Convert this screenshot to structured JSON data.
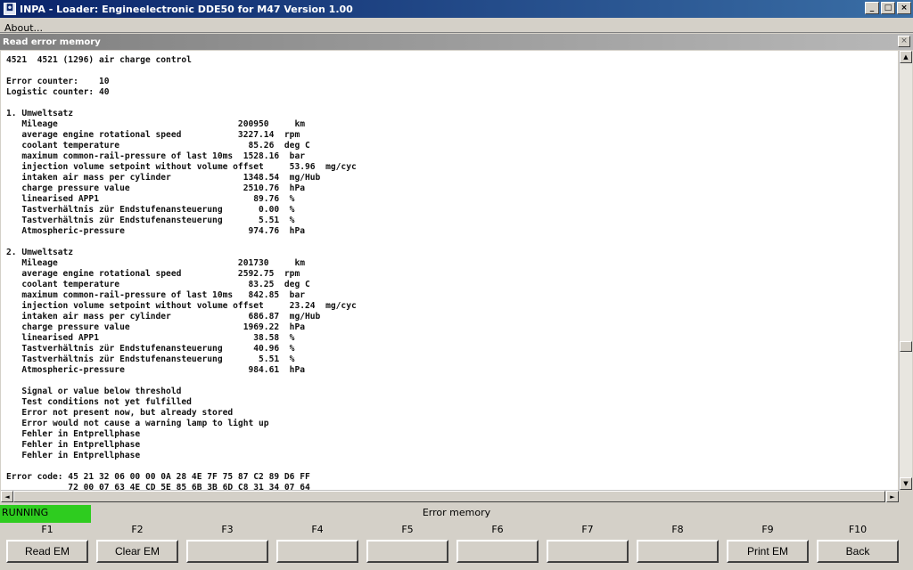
{
  "window": {
    "title": "INPA - Loader: Engineelectronic DDE50 for M47 Version 1.00",
    "icon_name": "inpa-app-icon",
    "min_label": "_",
    "max_label": "□",
    "close_label": "×"
  },
  "menu": {
    "about_label": "About..."
  },
  "subwindow": {
    "title": "Read error memory",
    "close_label": "×"
  },
  "report_lines": [
    "4521  4521 (1296) air charge control",
    "",
    "Error counter:    10",
    "Logistic counter: 40",
    "",
    "1. Umweltsatz",
    "   Mileage                                   200950     km",
    "   average engine rotational speed           3227.14  rpm",
    "   coolant temperature                         85.26  deg C",
    "   maximum common-rail-pressure of last 10ms  1528.16  bar",
    "   injection volume setpoint without volume offset     53.96  mg/cyc",
    "   intaken air mass per cylinder              1348.54  mg/Hub",
    "   charge pressure value                      2510.76  hPa",
    "   linearised APP1                              89.76  %",
    "   Tastverhältnis zür Endstufenansteuerung       0.00  %",
    "   Tastverhältnis zür Endstufenansteuerung       5.51  %",
    "   Atmospheric-pressure                        974.76  hPa",
    "",
    "2. Umweltsatz",
    "   Mileage                                   201730     km",
    "   average engine rotational speed           2592.75  rpm",
    "   coolant temperature                         83.25  deg C",
    "   maximum common-rail-pressure of last 10ms   842.85  bar",
    "   injection volume setpoint without volume offset     23.24  mg/cyc",
    "   intaken air mass per cylinder               686.87  mg/Hub",
    "   charge pressure value                      1969.22  hPa",
    "   linearised APP1                              38.58  %",
    "   Tastverhältnis zür Endstufenansteuerung      40.96  %",
    "   Tastverhältnis zür Endstufenansteuerung       5.51  %",
    "   Atmospheric-pressure                        984.61  hPa",
    "",
    "   Signal or value below threshold",
    "   Test conditions not yet fulfilled",
    "   Error not present now, but already stored",
    "   Error would not cause a warning lamp to light up",
    "   Fehler in Entprellphase",
    "   Fehler in Entprellphase",
    "   Fehler in Entprellphase",
    "",
    "Error code: 45 21 32 06 00 00 0A 28 4E 7F 75 87 C2 89 D6 FF",
    "            72 00 07 63 4E CD 5E 85 6B 3B 6D C8 31 34 07 64"
  ],
  "status": {
    "running_label": "RUNNING",
    "running_color": "#2ecc1f",
    "caption": "Error memory"
  },
  "fkeys": [
    {
      "key": "F1",
      "label": "Read EM"
    },
    {
      "key": "F2",
      "label": "Clear EM"
    },
    {
      "key": "F3",
      "label": ""
    },
    {
      "key": "F4",
      "label": ""
    },
    {
      "key": "F5",
      "label": ""
    },
    {
      "key": "F6",
      "label": ""
    },
    {
      "key": "F7",
      "label": ""
    },
    {
      "key": "F8",
      "label": ""
    },
    {
      "key": "F9",
      "label": "Print EM"
    },
    {
      "key": "F10",
      "label": "Back"
    }
  ],
  "scroll": {
    "up_arrow": "▲",
    "down_arrow": "▼",
    "left_arrow": "◄",
    "right_arrow": "►"
  }
}
